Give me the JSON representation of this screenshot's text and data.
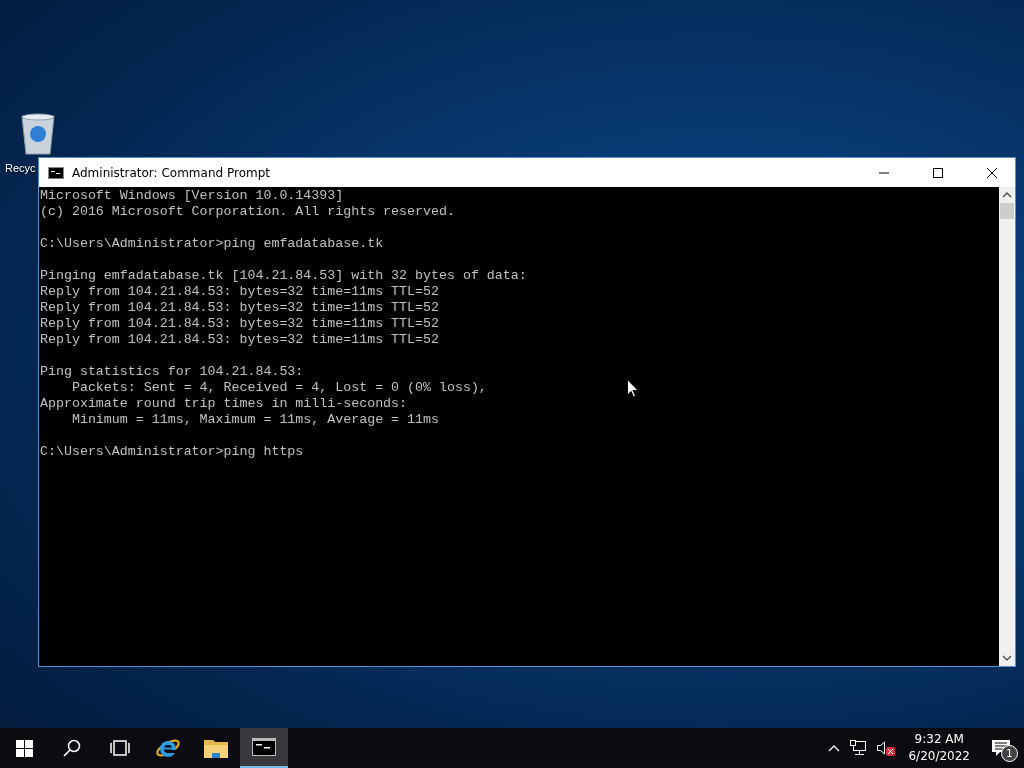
{
  "desktop": {
    "icons": [
      {
        "label": "Recyc"
      }
    ]
  },
  "window": {
    "title": "Administrator: Command Prompt",
    "active": true,
    "console": [
      [
        "Microsoft Windows [Version 10.0.14393]",
        "(c) 2016 Microsoft Corporation. All rights reserved."
      ],
      [
        "C:\\Users\\Administrator>ping emfadatabase.tk"
      ],
      [
        "Pinging emfadatabase.tk [104.21.84.53] with 32 bytes of data:",
        "Reply from 104.21.84.53: bytes=32 time=11ms TTL=52",
        "Reply from 104.21.84.53: bytes=32 time=11ms TTL=52",
        "Reply from 104.21.84.53: bytes=32 time=11ms TTL=52",
        "Reply from 104.21.84.53: bytes=32 time=11ms TTL=52"
      ],
      [
        "Ping statistics for 104.21.84.53:",
        "    Packets: Sent = 4, Received = 4, Lost = 0 (0% loss),",
        "Approximate round trip times in milli-seconds:",
        "    Minimum = 11ms, Maximum = 11ms, Average = 11ms"
      ],
      [
        "C:\\Users\\Administrator>ping https"
      ]
    ]
  },
  "taskbar": {
    "apps": [
      {
        "kind": "start",
        "selected": false
      },
      {
        "kind": "search",
        "selected": false
      },
      {
        "kind": "taskview",
        "selected": false
      },
      {
        "kind": "browser",
        "selected": false
      },
      {
        "kind": "folder",
        "selected": false
      },
      {
        "kind": "console",
        "selected": true
      }
    ],
    "tray": {
      "volume_muted": true,
      "time": "9:32 AM",
      "date": "6/20/2022",
      "notifications": "1"
    }
  }
}
